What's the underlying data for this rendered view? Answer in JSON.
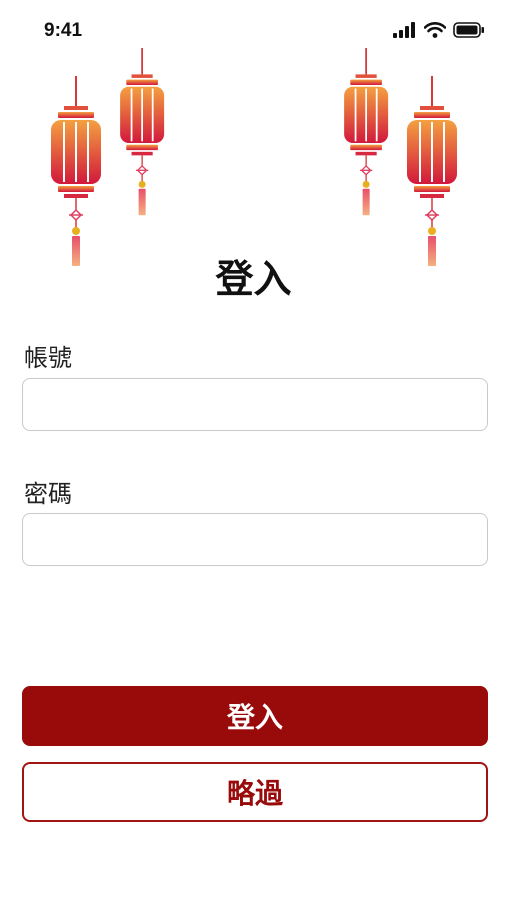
{
  "status_bar": {
    "time": "9:41"
  },
  "title": "登入",
  "form": {
    "account_label": "帳號",
    "account_value": "",
    "password_label": "密碼",
    "password_value": ""
  },
  "buttons": {
    "login_label": "登入",
    "skip_label": "略過"
  },
  "icons": {
    "signal": "cellular-signal-icon",
    "wifi": "wifi-icon",
    "battery": "battery-icon",
    "decoration": "lantern-icon"
  },
  "colors": {
    "primary": "#990a0a",
    "lantern_top": "#f08a3c",
    "lantern_bottom": "#d21e3c"
  }
}
